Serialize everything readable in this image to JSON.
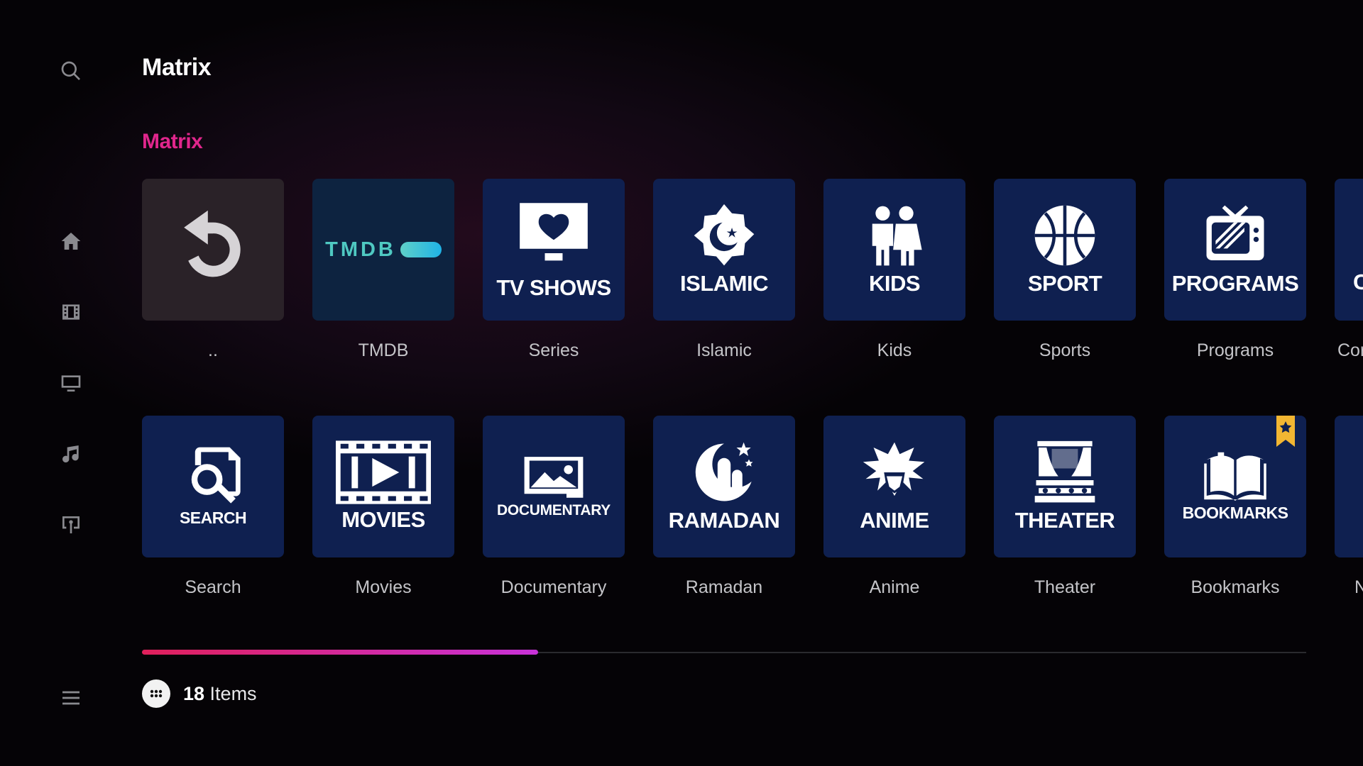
{
  "header": {
    "title": "Matrix"
  },
  "section": {
    "title": "Matrix"
  },
  "sidebar": {
    "icons": [
      "search-icon",
      "home-icon",
      "movies-icon",
      "tv-icon",
      "music-icon",
      "remote-icon",
      "menu-icon"
    ]
  },
  "row1": [
    {
      "art": "back-arrow",
      "caption": ".."
    },
    {
      "art": "tmdb-logo",
      "art_text": "TMDB",
      "caption": "TMDB"
    },
    {
      "art": "tv-heart",
      "art_text": "TV SHOWS",
      "caption": "Series"
    },
    {
      "art": "crescent-star",
      "art_text": "ISLAMIC",
      "caption": "Islamic"
    },
    {
      "art": "kids",
      "art_text": "KIDS",
      "caption": "Kids"
    },
    {
      "art": "basketball",
      "art_text": "SPORT",
      "caption": "Sports"
    },
    {
      "art": "retro-tv",
      "art_text": "PROGRAMS",
      "caption": "Programs"
    },
    {
      "art": "partial",
      "art_text": "C",
      "caption": "Cor"
    }
  ],
  "row2": [
    {
      "art": "search-doc",
      "art_text": "SEARCH",
      "caption": "Search"
    },
    {
      "art": "film-play",
      "art_text": "MOVIES",
      "caption": "Movies"
    },
    {
      "art": "landscape-frame",
      "art_text": "DOCUMENTARY",
      "caption": "Documentary"
    },
    {
      "art": "ramadan",
      "art_text": "RAMADAN",
      "caption": "Ramadan"
    },
    {
      "art": "anime-hair",
      "art_text": "ANIME",
      "caption": "Anime"
    },
    {
      "art": "theater-stage",
      "art_text": "THEATER",
      "caption": "Theater"
    },
    {
      "art": "open-book",
      "art_text": "BOOKMARKS",
      "caption": "Bookmarks",
      "flagged": true
    },
    {
      "art": "partial",
      "art_text": "",
      "caption": "N"
    }
  ],
  "scroll": {
    "progress": 0.34
  },
  "footer": {
    "count": "18",
    "label": " Items"
  },
  "colors": {
    "accent": "#e0268c",
    "tile": "#0f2050",
    "background": "#050306",
    "bookmark": "#f2b632"
  }
}
